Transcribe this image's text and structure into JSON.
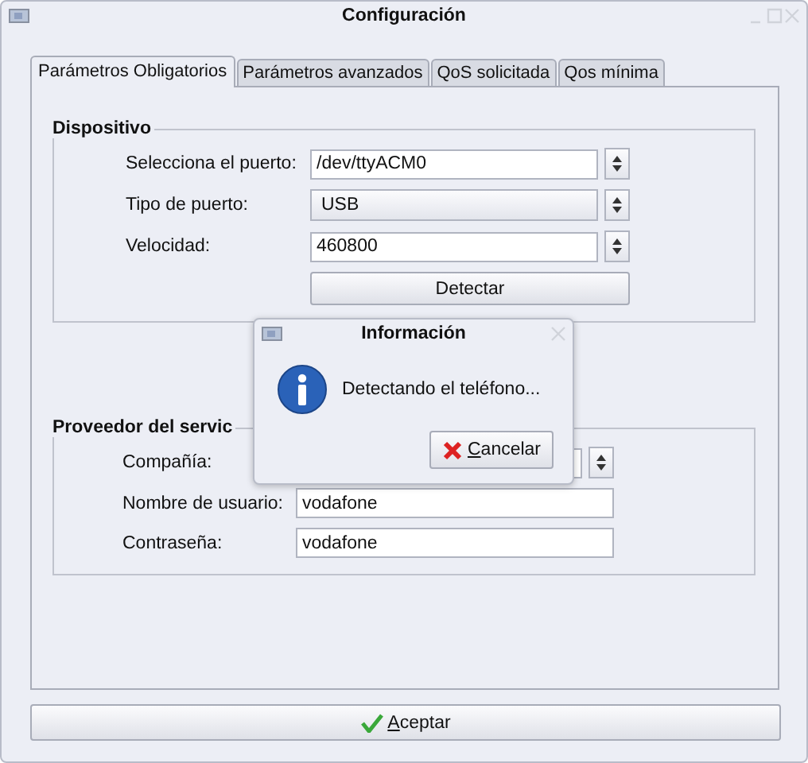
{
  "window": {
    "title": "Configuración"
  },
  "tabs": [
    {
      "label": "Parámetros Obligatorios",
      "selected": true
    },
    {
      "label": "Parámetros avanzados",
      "selected": false
    },
    {
      "label": "QoS solicitada",
      "selected": false
    },
    {
      "label": "Qos mínima",
      "selected": false
    }
  ],
  "groups": [
    {
      "title": "Dispositivo",
      "rows": [
        {
          "kind": "combo-entry",
          "label": "Selecciona el puerto:",
          "value": "/dev/ttyACM0"
        },
        {
          "kind": "combo",
          "label": "Tipo de puerto:",
          "value": "USB"
        },
        {
          "kind": "combo-entry",
          "label": "Velocidad:",
          "value": "460800"
        },
        {
          "kind": "button",
          "label": "Detectar"
        }
      ]
    },
    {
      "title": "Proveedor del servic",
      "rows": [
        {
          "kind": "combo-entry",
          "label": "Compañía:"
        },
        {
          "kind": "entry",
          "label": "Nombre de usuario:",
          "value": "vodafone"
        },
        {
          "kind": "entry",
          "label": "Contraseña:",
          "value": "vodafone"
        }
      ]
    }
  ],
  "dialog": {
    "title": "Información",
    "message": "Detectando el teléfono...",
    "button": "Cancelar"
  },
  "accept_button": "Aceptar"
}
